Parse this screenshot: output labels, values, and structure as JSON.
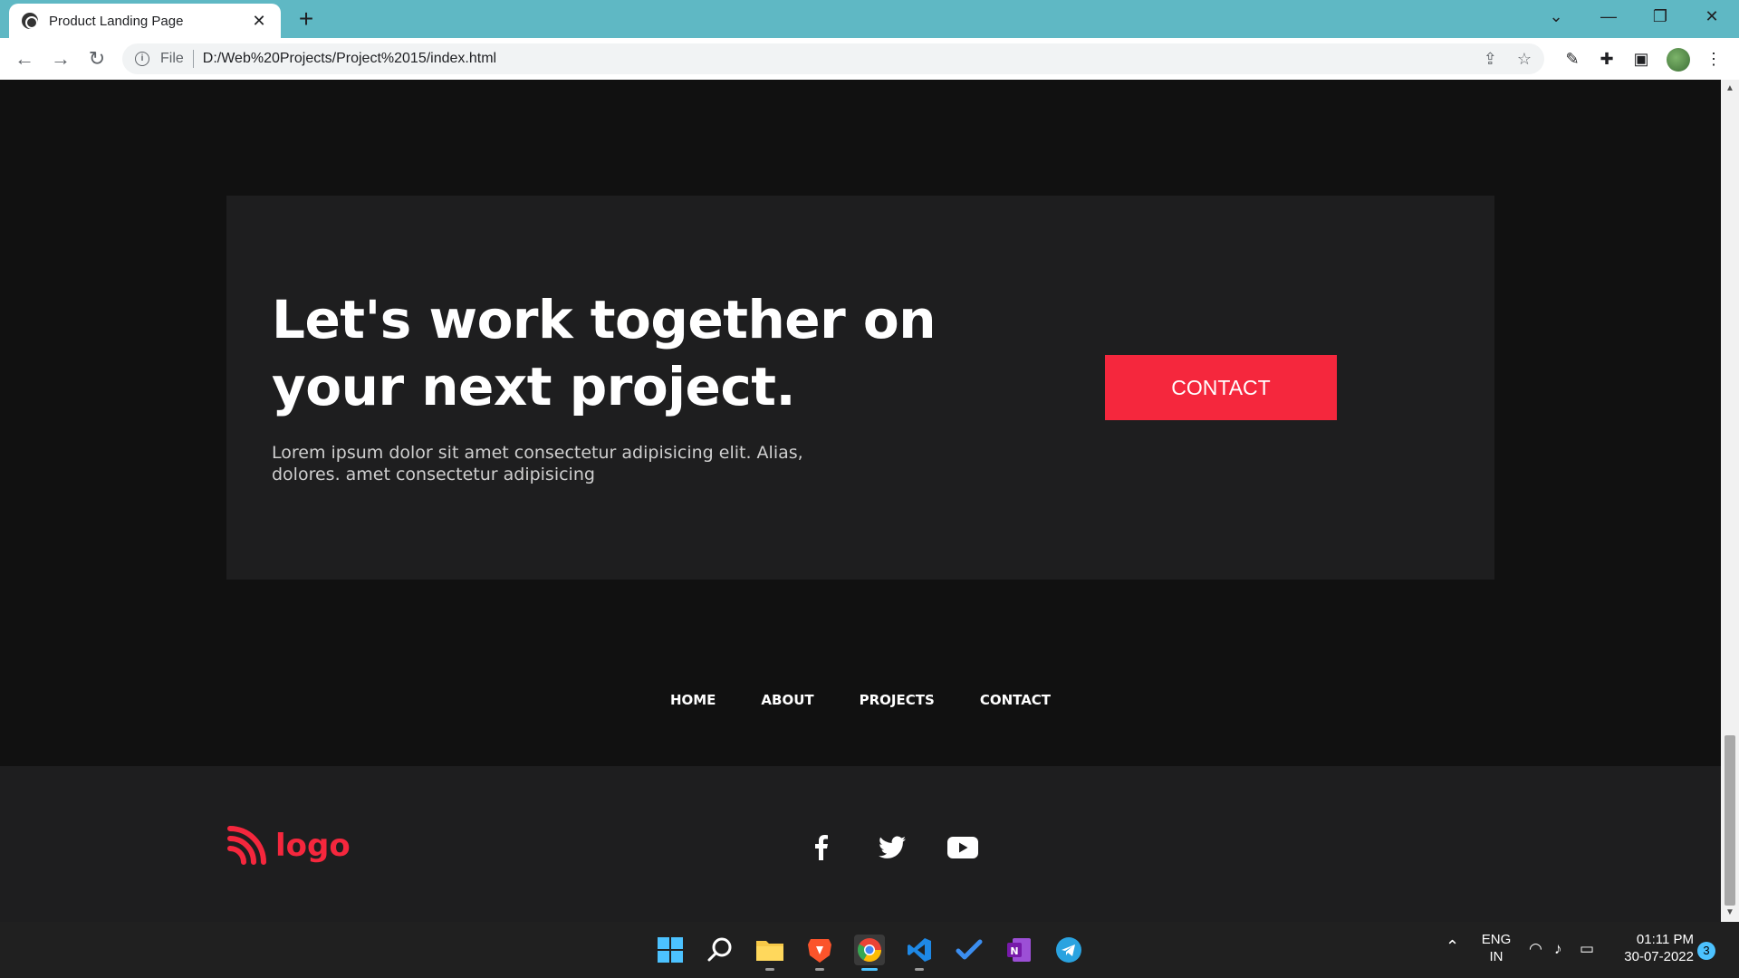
{
  "browser": {
    "tab_title": "Product Landing Page",
    "tab_close": "✕",
    "new_tab": "+",
    "address_scheme": "File",
    "address_url": "D:/Web%20Projects/Project%2015/index.html",
    "window_controls": {
      "list": "⌄",
      "minimize": "—",
      "restore": "❐",
      "close": "✕"
    }
  },
  "page": {
    "cta": {
      "heading": "Let's work together on your next project.",
      "body": "Lorem ipsum dolor sit amet consectetur adipisicing elit. Alias, dolores. amet consectetur adipisicing",
      "button_label": "CONTACT"
    },
    "footer_nav": [
      "HOME",
      "ABOUT",
      "PROJECTS",
      "CONTACT"
    ],
    "footer": {
      "logo_text": "logo",
      "socials": [
        "facebook-icon",
        "twitter-icon",
        "youtube-icon"
      ]
    },
    "colors": {
      "accent": "#f5273d",
      "background": "#111111",
      "panel": "#1e1e1f"
    }
  },
  "taskbar": {
    "apps": [
      "windows-start-icon",
      "search-icon",
      "file-explorer-icon",
      "brave-icon",
      "chrome-icon",
      "vscode-icon",
      "todo-icon",
      "onenote-icon",
      "telegram-icon"
    ],
    "language_line1": "ENG",
    "language_line2": "IN",
    "time": "01:11 PM",
    "date": "30-07-2022",
    "notification_count": "3"
  }
}
